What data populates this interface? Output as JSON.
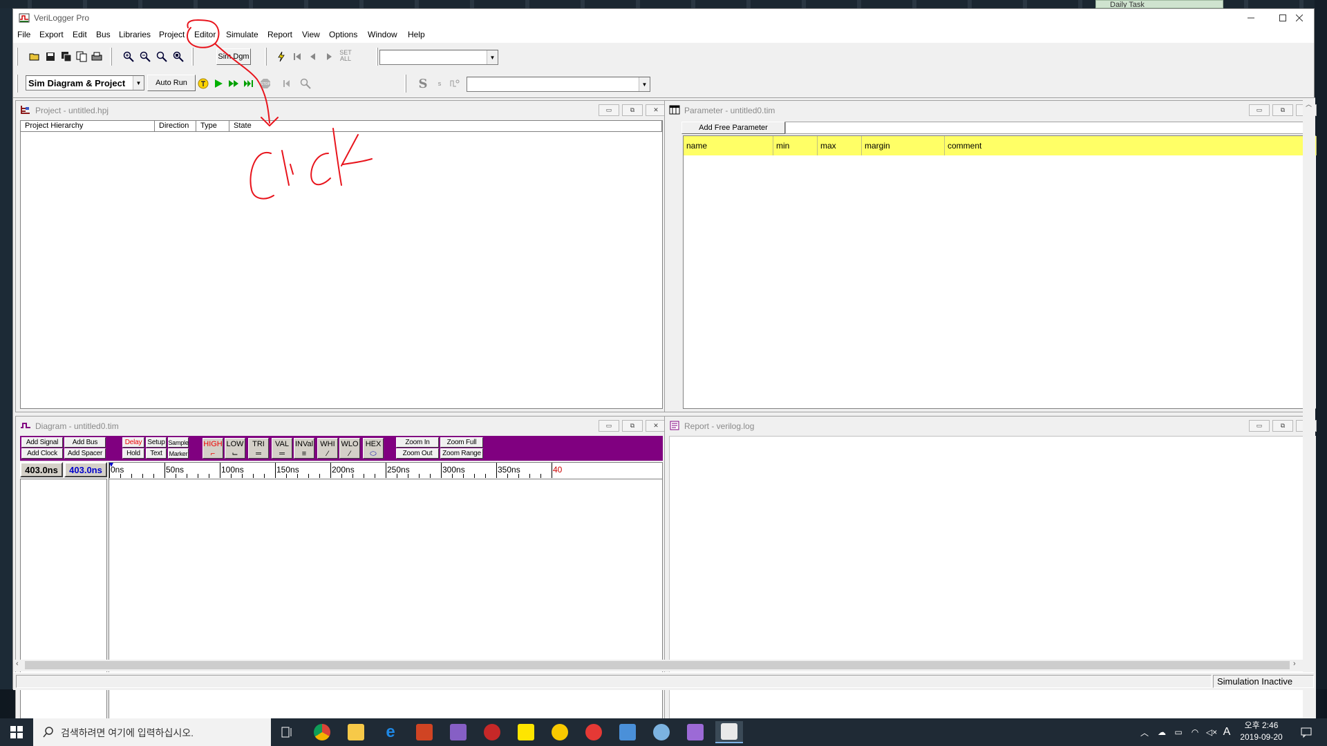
{
  "window": {
    "title": "VeriLogger Pro"
  },
  "menu": [
    "File",
    "Export",
    "Edit",
    "Bus",
    "Libraries",
    "Project",
    "Editor",
    "Simulate",
    "Report",
    "View",
    "Options",
    "Window",
    "Help"
  ],
  "toolbar": {
    "sim_dgm": "Sim Dgm",
    "set": "SET",
    "all": "ALL",
    "mode_select": "Sim Diagram & Project",
    "auto_run": "Auto Run",
    "stop": "STOP"
  },
  "project_window": {
    "title": "Project - untitled.hpj",
    "columns": [
      "Project Hierarchy",
      "Direction",
      "Type",
      "State"
    ]
  },
  "parameter_window": {
    "title": "Parameter - untitled0.tim",
    "add_button": "Add Free Parameter",
    "columns": [
      "name",
      "min",
      "max",
      "margin",
      "comment"
    ]
  },
  "diagram_window": {
    "title": "Diagram - untitled0.tim",
    "buttons": {
      "add_signal": "Add Signal",
      "add_bus": "Add Bus",
      "add_clock": "Add Clock",
      "add_spacer": "Add Spacer",
      "delay": "Delay",
      "setup": "Setup",
      "sample": "Sample",
      "hold": "Hold",
      "text": "Text",
      "marker": "Marker",
      "zoom_in": "Zoom In",
      "zoom_full": "Zoom Full",
      "zoom_out": "Zoom Out",
      "zoom_range": "Zoom Range"
    },
    "waveform_buttons": [
      "HIGH",
      "LOW",
      "TRI",
      "VAL",
      "INVal",
      "WHI",
      "WLO",
      "HEX"
    ],
    "time_left": "403.0ns",
    "time_right": "403.0ns",
    "ticks": [
      "0ns",
      "50ns",
      "100ns",
      "150ns",
      "200ns",
      "250ns",
      "300ns",
      "350ns",
      "40"
    ]
  },
  "report_window": {
    "title": "Report - verilog.log"
  },
  "status": {
    "text": "Simulation Inactive"
  },
  "desktop": {
    "daily_task": "Daily Task"
  },
  "taskbar": {
    "search_placeholder": "검색하려면 여기에 입력하십시오.",
    "time": "오후 2:46",
    "date": "2019-09-20",
    "ime": "A"
  },
  "annotation": {
    "text": "click",
    "color": "#e8141c"
  },
  "colors": {
    "diagram_toolbar": "#800080",
    "param_header": "#ffff66",
    "time_blue": "#0000cc"
  }
}
